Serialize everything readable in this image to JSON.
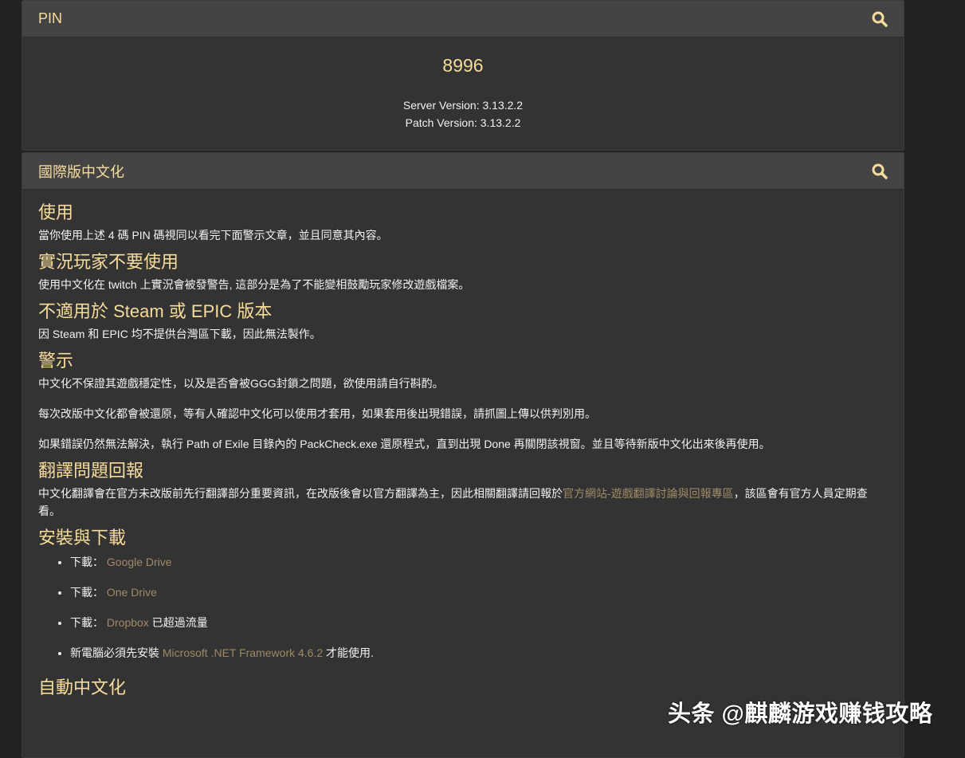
{
  "pin_panel": {
    "title": "PIN",
    "code": "8996",
    "server_version": "Server Version: 3.13.2.2",
    "patch_version": "Patch Version: 3.13.2.2"
  },
  "cn_panel": {
    "title": "國際版中文化",
    "sections": {
      "usage": {
        "heading": "使用",
        "text": "當你使用上述 4 碼 PIN 碼視同以看完下面警示文章，並且同意其內容。"
      },
      "streamer": {
        "heading": "實況玩家不要使用",
        "text": "使用中文化在 twitch 上實況會被發警告, 這部分是為了不能變相鼓勵玩家修改遊戲檔案。"
      },
      "steam": {
        "heading": "不適用於 Steam 或 EPIC 版本",
        "text": "因 Steam 和 EPIC 均不提供台灣區下載，因此無法製作。"
      },
      "warning": {
        "heading": "警示",
        "p1": "中文化不保證其遊戲穩定性，以及是否會被GGG封鎖之問題，欲使用請自行斟酌。",
        "p2": "每次改版中文化都會被還原，等有人確認中文化可以使用才套用，如果套用後出現錯誤，請抓圖上傳以供判別用。",
        "p3": "如果錯誤仍然無法解決，執行 Path of Exile 目錄內的 PackCheck.exe 還原程式，直到出現 Done 再關閉該視窗。並且等待新版中文化出來後再使用。"
      },
      "report": {
        "heading": "翻譯問題回報",
        "text_before": "中文化翻譯會在官方未改版前先行翻譯部分重要資訊，在改版後會以官方翻譯為主，因此相關翻譯請回報於",
        "link": "官方網站-遊戲翻譯討論與回報專區",
        "text_after": "，該區會有官方人員定期查看。"
      },
      "install": {
        "heading": "安裝與下載",
        "items": [
          {
            "prefix": "下載：",
            "link": "Google Drive",
            "suffix": ""
          },
          {
            "prefix": "下載：",
            "link": "One Drive",
            "suffix": ""
          },
          {
            "prefix": "下載：",
            "link": "Dropbox",
            "suffix": " 已超過流量"
          },
          {
            "prefix": "新電腦必須先安裝 ",
            "link": "Microsoft .NET Framework 4.6.2",
            "suffix": " 才能使用."
          }
        ]
      },
      "auto": {
        "heading": "自動中文化"
      }
    }
  },
  "watermark": "头条 @麒麟游戏赚钱攻略",
  "colors": {
    "accent": "#f7dc9b",
    "link": "#a08a66",
    "panel_bg": "#333333",
    "header_bg": "#444444",
    "page_bg": "#222222"
  },
  "icons": {
    "search": "search-icon"
  }
}
